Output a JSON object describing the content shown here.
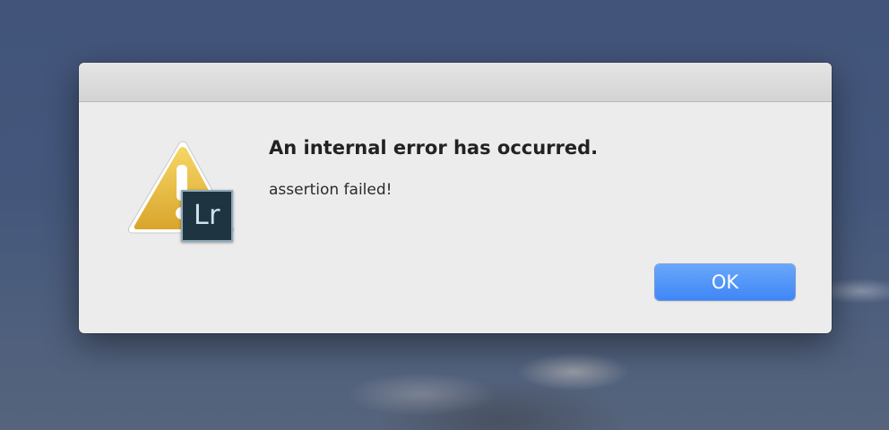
{
  "dialog": {
    "heading": "An internal error has occurred.",
    "message": "assertion failed!",
    "ok_label": "OK",
    "icon": "warning-triangle-icon",
    "app_badge_text": "Lr",
    "accent_color": "#3f86f6"
  }
}
